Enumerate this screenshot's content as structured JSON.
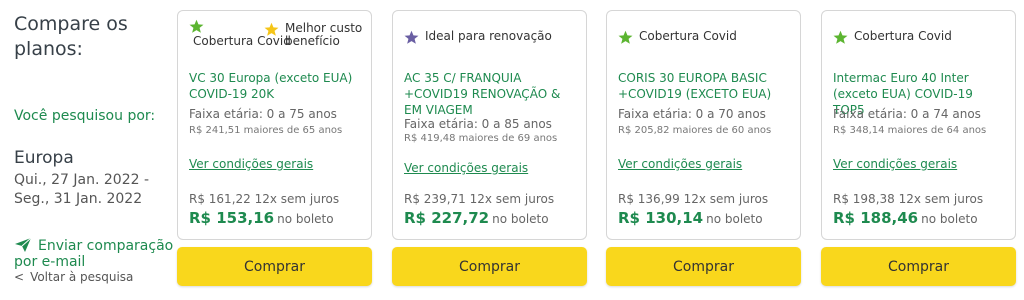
{
  "sidebar": {
    "title_line1": "Compare os",
    "title_line2": "planos:",
    "searched_label": "Você pesquisou por:",
    "destination": "Europa",
    "dates": "Qui., 27 Jan. 2022 - Seg., 31 Jan. 2022",
    "send_comparison": "Enviar comparação por e-mail",
    "back_link": "Voltar à pesquisa"
  },
  "colors": {
    "green": "#1e8a4f",
    "star_green": "#5cb531",
    "star_yellow": "#f5c518",
    "star_purple": "#6a5fa3",
    "button_yellow": "#f9d71c"
  },
  "plans": [
    {
      "tag1": "Cobertura Covid",
      "tag1_icon": "star-green-icon",
      "tag2": "Melhor custo benefício",
      "tag2_icon": "star-yellow-icon",
      "name": "VC 30 Europa (exceto EUA) COVID-19 20K",
      "age_range": "Faixa etária: 0 a 75 anos",
      "age_extra": "R$ 241,51 maiores de 65 anos",
      "conditions_link": "Ver condições gerais",
      "installment": "R$ 161,22 12x sem juros",
      "price": "R$ 153,16",
      "price_suffix": "no boleto",
      "buy_label": "Comprar"
    },
    {
      "tag1": "Ideal para renovação",
      "tag1_icon": "star-purple-icon",
      "name": "AC 35 C/ FRANQUIA +COVID19 RENOVAÇÃO & EM VIAGEM",
      "age_range": "Faixa etária: 0 a 85 anos",
      "age_extra": "R$ 419,48 maiores de 69 anos",
      "conditions_link": "Ver condições gerais",
      "installment": "R$ 239,71 12x sem juros",
      "price": "R$ 227,72",
      "price_suffix": "no boleto",
      "buy_label": "Comprar"
    },
    {
      "tag1": "Cobertura Covid",
      "tag1_icon": "star-green-icon",
      "name": "CORIS 30 EUROPA BASIC +COVID19 (EXCETO EUA)",
      "age_range": "Faixa etária: 0 a 70 anos",
      "age_extra": "R$ 205,82 maiores de 60 anos",
      "conditions_link": "Ver condições gerais",
      "installment": "R$ 136,99 12x sem juros",
      "price": "R$ 130,14",
      "price_suffix": "no boleto",
      "buy_label": "Comprar"
    },
    {
      "tag1": "Cobertura Covid",
      "tag1_icon": "star-green-icon",
      "name": "Intermac Euro 40 Inter (exceto EUA) COVID-19 TOP5",
      "age_range": "Faixa etária: 0 a 74 anos",
      "age_extra": "R$ 348,14 maiores de 64 anos",
      "conditions_link": "Ver condições gerais",
      "installment": "R$ 198,38 12x sem juros",
      "price": "R$ 188,46",
      "price_suffix": "no boleto",
      "buy_label": "Comprar"
    }
  ]
}
